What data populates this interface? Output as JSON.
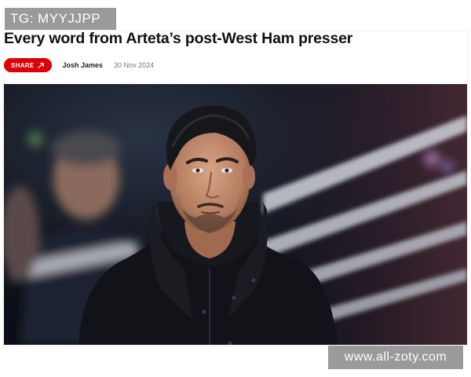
{
  "watermarks": {
    "top": "TG: MYYJJPP",
    "bottom": "www.all-zoty.com"
  },
  "article": {
    "headline": "Every word from Arteta’s post-West Ham presser",
    "share_label": "SHARE",
    "author": "Josh James",
    "date": "30 Nov 2024"
  },
  "icons": {
    "share": "share-arrow-icon"
  },
  "colors": {
    "brand_red": "#db0007",
    "headline": "#111111",
    "watermark_bg": "#9a9a9a"
  }
}
